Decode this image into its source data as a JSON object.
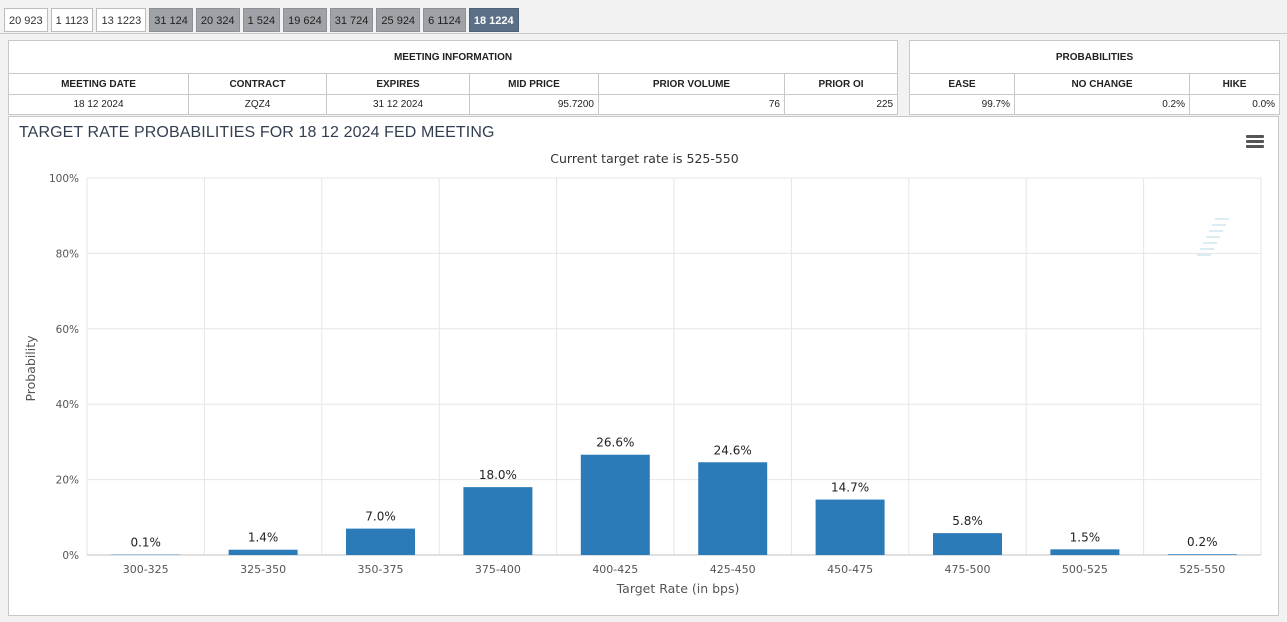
{
  "tabs": [
    {
      "label": "20 923",
      "style": "white"
    },
    {
      "label": "1 1123",
      "style": "white"
    },
    {
      "label": "13 1223",
      "style": "white"
    },
    {
      "label": "31 124",
      "style": "gray"
    },
    {
      "label": "20 324",
      "style": "gray"
    },
    {
      "label": "1 524",
      "style": "gray"
    },
    {
      "label": "19 624",
      "style": "gray"
    },
    {
      "label": "31 724",
      "style": "gray"
    },
    {
      "label": "25 924",
      "style": "gray"
    },
    {
      "label": "6 1124",
      "style": "gray"
    },
    {
      "label": "18 1224",
      "style": "active"
    }
  ],
  "meeting_info": {
    "title": "MEETING INFORMATION",
    "headers": [
      "MEETING DATE",
      "CONTRACT",
      "EXPIRES",
      "MID PRICE",
      "PRIOR VOLUME",
      "PRIOR OI"
    ],
    "values": [
      "18 12 2024",
      "ZQZ4",
      "31 12 2024",
      "95.7200",
      "76",
      "225"
    ]
  },
  "probabilities": {
    "title": "PROBABILITIES",
    "headers": [
      "EASE",
      "NO CHANGE",
      "HIKE"
    ],
    "values": [
      "99.7%",
      "0.2%",
      "0.0%"
    ]
  },
  "chart": {
    "title": "TARGET RATE PROBABILITIES FOR 18 12 2024 FED MEETING",
    "subtitle": "Current target rate is 525-550",
    "menu_icon": "hamburger-menu-icon",
    "watermark_icon": "cme-q-logo-icon",
    "bar_color": "#2b7bb9"
  },
  "chart_data": {
    "type": "bar",
    "title": "TARGET RATE PROBABILITIES FOR 18 12 2024 FED MEETING",
    "subtitle": "Current target rate is 525-550",
    "xlabel": "Target Rate (in bps)",
    "ylabel": "Probability",
    "ylim": [
      0,
      100
    ],
    "yticks": [
      "0%",
      "20%",
      "40%",
      "60%",
      "80%",
      "100%"
    ],
    "grid": true,
    "categories": [
      "300-325",
      "325-350",
      "350-375",
      "375-400",
      "400-425",
      "425-450",
      "450-475",
      "475-500",
      "500-525",
      "525-550"
    ],
    "values": [
      0.1,
      1.4,
      7.0,
      18.0,
      26.6,
      24.6,
      14.7,
      5.8,
      1.5,
      0.2
    ],
    "data_labels": [
      "0.1%",
      "1.4%",
      "7.0%",
      "18.0%",
      "26.6%",
      "24.6%",
      "14.7%",
      "5.8%",
      "1.5%",
      "0.2%"
    ]
  }
}
